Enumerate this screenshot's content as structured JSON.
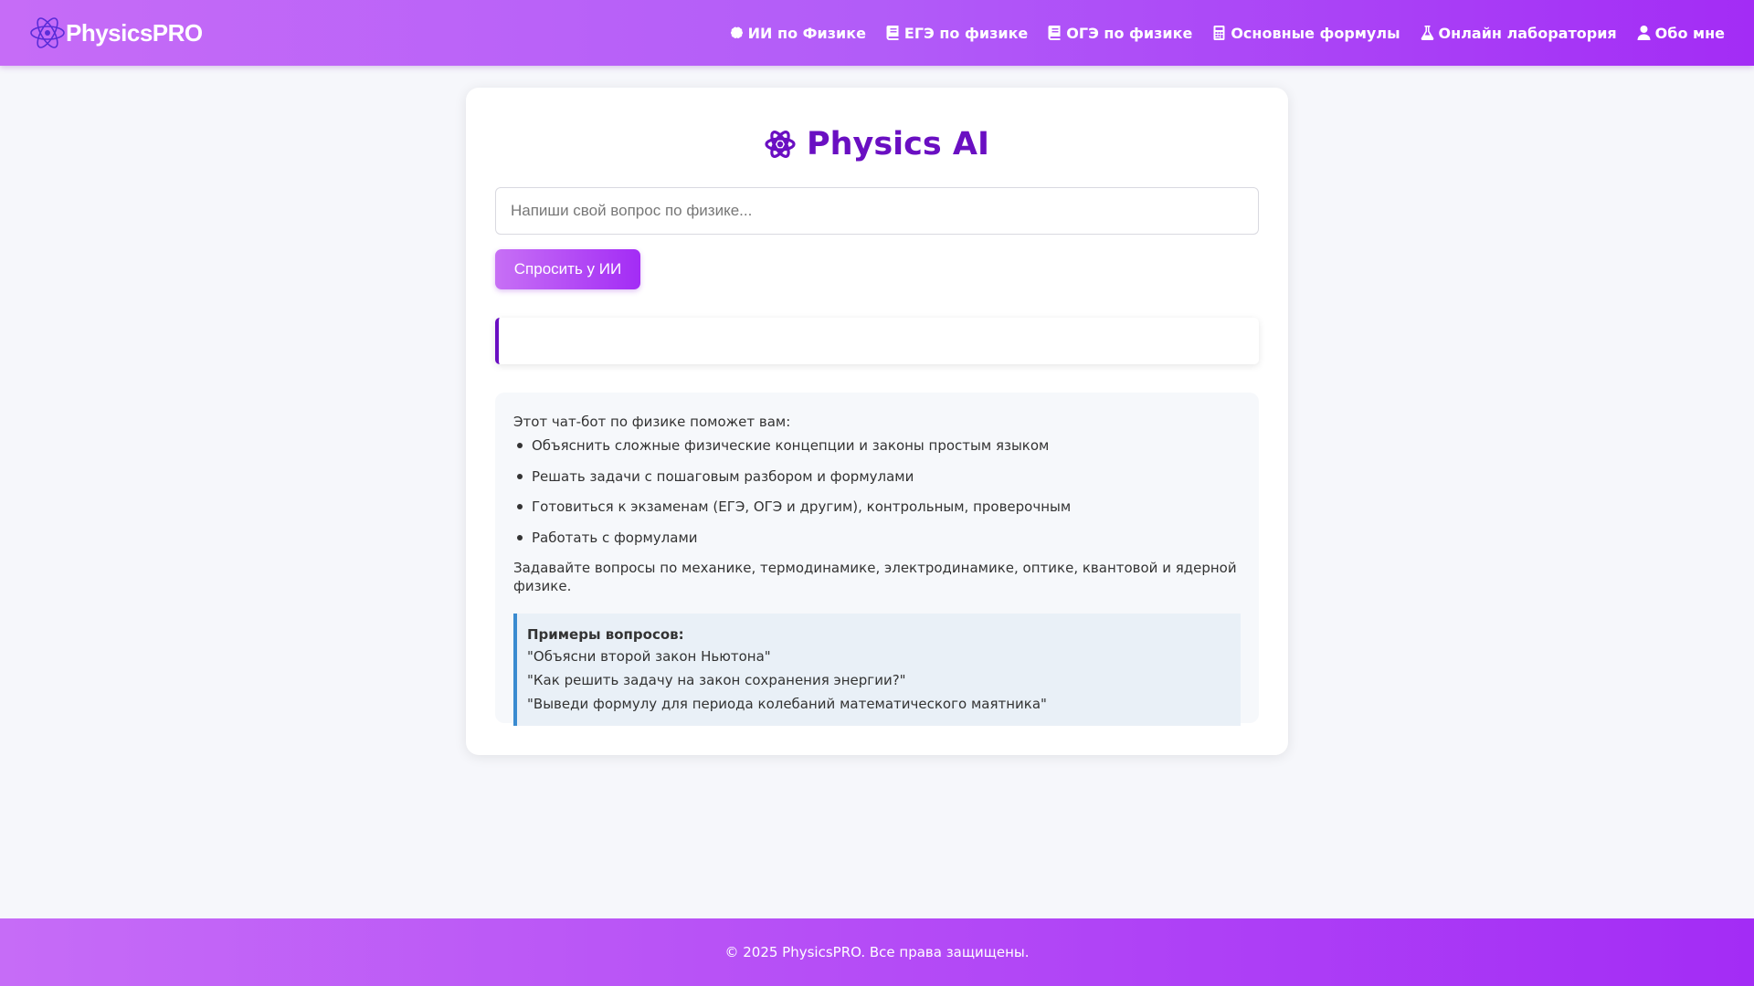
{
  "header": {
    "logo_text": "PhysicsPRO",
    "nav": [
      {
        "label": "ИИ по Физике",
        "icon": "brain-icon"
      },
      {
        "label": "ЕГЭ по физике",
        "icon": "book-icon"
      },
      {
        "label": "ОГЭ по физике",
        "icon": "book-icon"
      },
      {
        "label": "Основные формулы",
        "icon": "calculator-icon"
      },
      {
        "label": "Онлайн лаборатория",
        "icon": "flask-icon"
      },
      {
        "label": "Обо мне",
        "icon": "user-icon"
      }
    ]
  },
  "main": {
    "title": "Physics AI",
    "title_icon": "atom-icon",
    "input_placeholder": "Напиши свой вопрос по физике...",
    "input_value": "",
    "ask_button": "Спросить у ИИ",
    "answer": "",
    "info": {
      "intro": "Этот чат-бот по физике поможет вам:",
      "items": [
        "Объяснить сложные физические концепции и законы простым языком",
        "Решать задачи с пошаговым разбором и формулами",
        "Готовиться к экзаменам (ЕГЭ, ОГЭ и другим), контрольным, проверочным",
        "Работать с формулами"
      ],
      "outro": "Задавайте вопросы по механике, термодинамике, электродинамике, оптике, квантовой и ядерной физике.",
      "examples_title": "Примеры вопросов:",
      "examples": [
        "\"Объясни второй закон Ньютона\"",
        "\"Как решить задачу на закон сохранения энергии?\"",
        "\"Выведи формулу для периода колебаний математического маятника\""
      ]
    }
  },
  "footer": {
    "text": "© 2025 PhysicsPRO. Все права защищены."
  },
  "colors": {
    "accent": "#6a0fc2",
    "header_start": "#c66cf7",
    "header_end": "#a32cf5",
    "example_border": "#3a8bd0"
  }
}
